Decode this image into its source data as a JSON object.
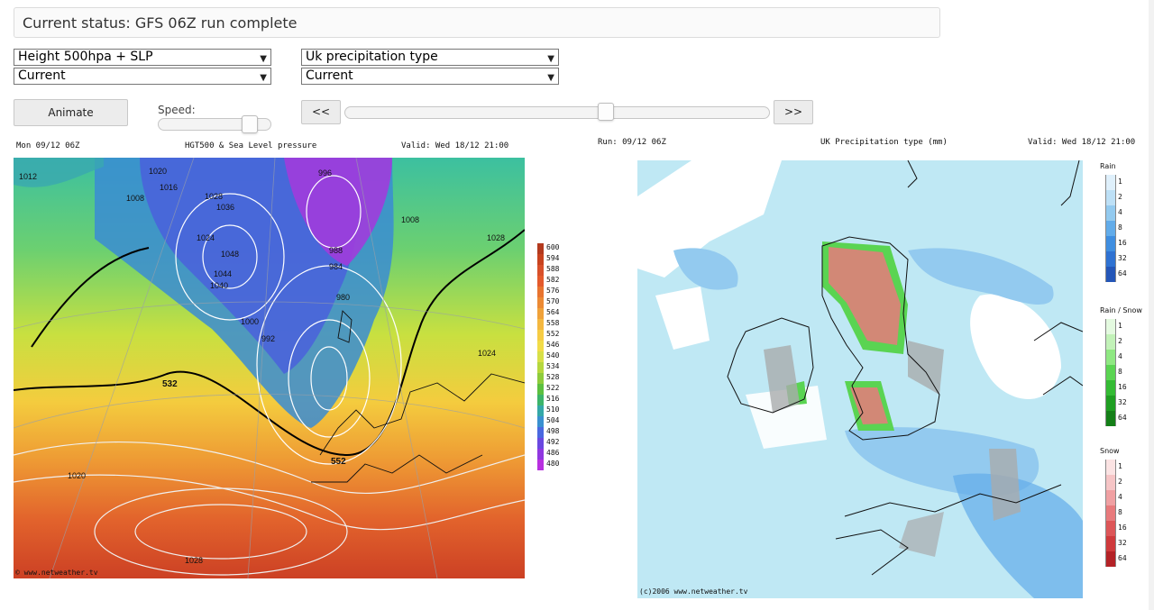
{
  "status": {
    "text": "Current status: GFS 06Z run complete"
  },
  "left_controls": {
    "chart_select": "Height 500hpa + SLP",
    "time_select": "Current"
  },
  "right_controls": {
    "chart_select": "Uk precipitation type",
    "time_select": "Current"
  },
  "animate": {
    "label": "Animate"
  },
  "speed": {
    "label": "Speed:"
  },
  "nav": {
    "prev_label": "<<",
    "next_label": ">>"
  },
  "left_chart": {
    "run_label": "Mon 09/12 06Z",
    "title": "HGT500 & Sea Level pressure",
    "valid_label": "Valid: Wed 18/12 21:00",
    "credit": "© www.netweather.tv",
    "scale_values": [
      "600",
      "594",
      "588",
      "582",
      "576",
      "570",
      "564",
      "558",
      "552",
      "546",
      "540",
      "534",
      "528",
      "522",
      "516",
      "510",
      "504",
      "498",
      "492",
      "486",
      "480"
    ],
    "scale_colors": [
      "#b33a1e",
      "#c8431f",
      "#d8502a",
      "#e45a2c",
      "#e8742f",
      "#ec8a34",
      "#f0a23a",
      "#f4b840",
      "#f6cc44",
      "#f2dc48",
      "#d8e048",
      "#b6d83e",
      "#8ecc3c",
      "#5cc040",
      "#3cb46a",
      "#34a8a8",
      "#3a90d0",
      "#4a68e0",
      "#6a48e0",
      "#9038e0",
      "#b830e0"
    ],
    "pressure_labels": [
      "1020",
      "1012",
      "1016",
      "1008",
      "1004",
      "1028",
      "1036",
      "1024",
      "1048",
      "1044",
      "1040",
      "1000",
      "992",
      "996",
      "988",
      "984",
      "980",
      "1032"
    ],
    "thickness_label": "532",
    "line_label": "552"
  },
  "right_chart": {
    "run_label": "Run: 09/12 06Z",
    "title": "UK Precipitation type (mm)",
    "valid_label": "Valid: Wed 18/12 21:00",
    "credit": "(c)2006 www.netweather.tv",
    "legend": [
      {
        "name": "Rain",
        "values": [
          "1",
          "2",
          "4",
          "8",
          "16",
          "32",
          "64"
        ],
        "colors": [
          "#dff0fb",
          "#bde0f6",
          "#93caef",
          "#62acea",
          "#3f8ee0",
          "#2f72d2",
          "#2456b8"
        ]
      },
      {
        "name": "Rain / Snow",
        "values": [
          "1",
          "2",
          "4",
          "8",
          "16",
          "32",
          "64"
        ],
        "colors": [
          "#e4fae0",
          "#c2f2b8",
          "#8fe882",
          "#5ad452",
          "#34bb34",
          "#1f9e22",
          "#147f18"
        ]
      },
      {
        "name": "Snow",
        "values": [
          "1",
          "2",
          "4",
          "8",
          "16",
          "32",
          "64"
        ],
        "colors": [
          "#fbe3e3",
          "#f6c5c6",
          "#f0a0a2",
          "#e87a7c",
          "#dd5658",
          "#cf3a3c",
          "#b42226"
        ]
      }
    ]
  }
}
